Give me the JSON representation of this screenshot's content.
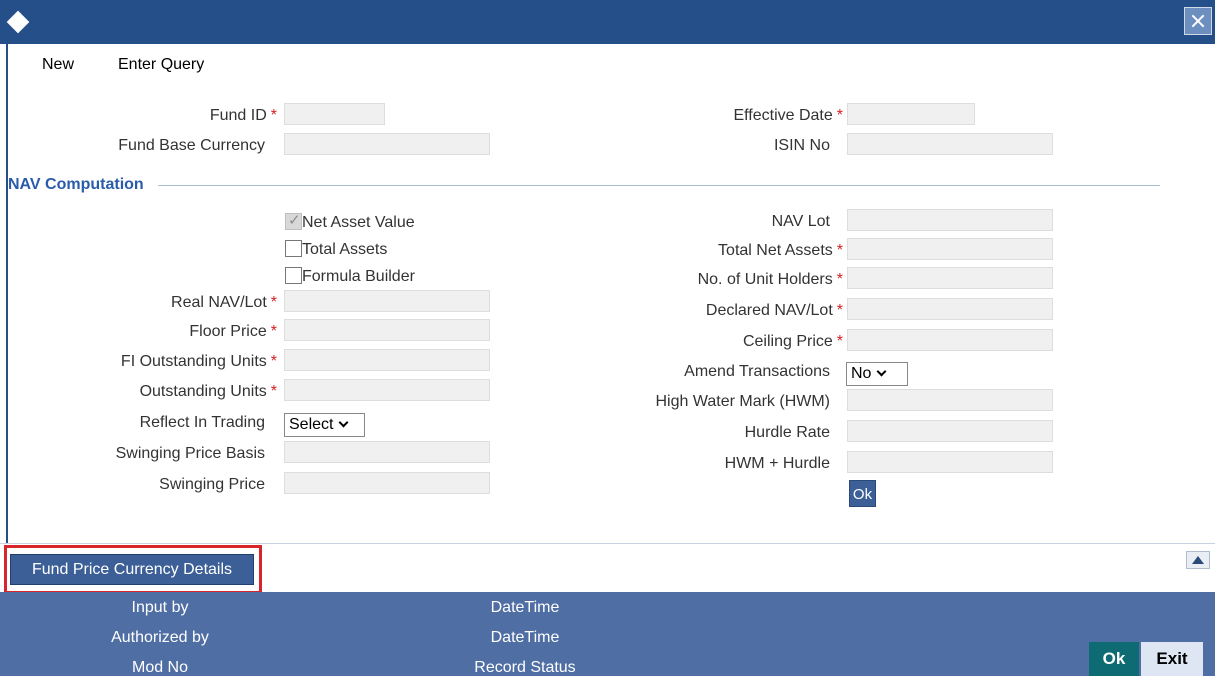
{
  "menu": {
    "new_label": "New",
    "enter_query_label": "Enter Query"
  },
  "header_fields": {
    "fund_id": {
      "label": "Fund ID",
      "value": ""
    },
    "fund_base_currency": {
      "label": "Fund Base Currency",
      "value": ""
    },
    "effective_date": {
      "label": "Effective Date",
      "value": ""
    },
    "isin_no": {
      "label": "ISIN No",
      "value": ""
    }
  },
  "required_marker": "*",
  "section": {
    "title": "NAV Computation"
  },
  "nav_options": {
    "net_asset_value": {
      "label": "Net Asset Value",
      "checked": true
    },
    "total_assets": {
      "label": "Total Assets",
      "checked": false
    },
    "formula_builder": {
      "label": "Formula Builder",
      "checked": false
    }
  },
  "left_fields": {
    "real_nav_lot": "Real NAV/Lot",
    "floor_price": "Floor Price",
    "fi_outstanding_units": "FI Outstanding Units",
    "outstanding_units": "Outstanding Units",
    "reflect_in_trading": "Reflect In Trading",
    "reflect_in_trading_value": "Select",
    "swinging_price_basis": "Swinging Price Basis",
    "swinging_price": "Swinging Price"
  },
  "right_fields": {
    "nav_lot": "NAV Lot",
    "total_net_assets": "Total Net Assets",
    "no_of_unit_holders": "No. of Unit Holders",
    "declared_nav_lot": "Declared NAV/Lot",
    "ceiling_price": "Ceiling Price",
    "amend_transactions": "Amend Transactions",
    "amend_transactions_value": "No",
    "hwm": "High Water Mark (HWM)",
    "hurdle_rate": "Hurdle Rate",
    "hwm_hurdle": "HWM + Hurdle",
    "ok_label": "Ok"
  },
  "tab": {
    "fund_price_currency_details": "Fund Price Currency Details"
  },
  "footer": {
    "input_by": "Input by",
    "authorized_by": "Authorized by",
    "mod_no": "Mod No",
    "datetime_1": "DateTime",
    "datetime_2": "DateTime",
    "record_status": "Record Status",
    "ok": "Ok",
    "exit": "Exit"
  },
  "colors": {
    "titlebar": "#254f89",
    "footer": "#4f6ea3",
    "accent": "#3b5f96",
    "required": "#d62020",
    "highlight": "#d7262b",
    "ok_button": "#0e6b74"
  },
  "icons": {
    "title": "diamond-icon",
    "close": "close-icon",
    "scroll": "scroll-up-icon"
  }
}
